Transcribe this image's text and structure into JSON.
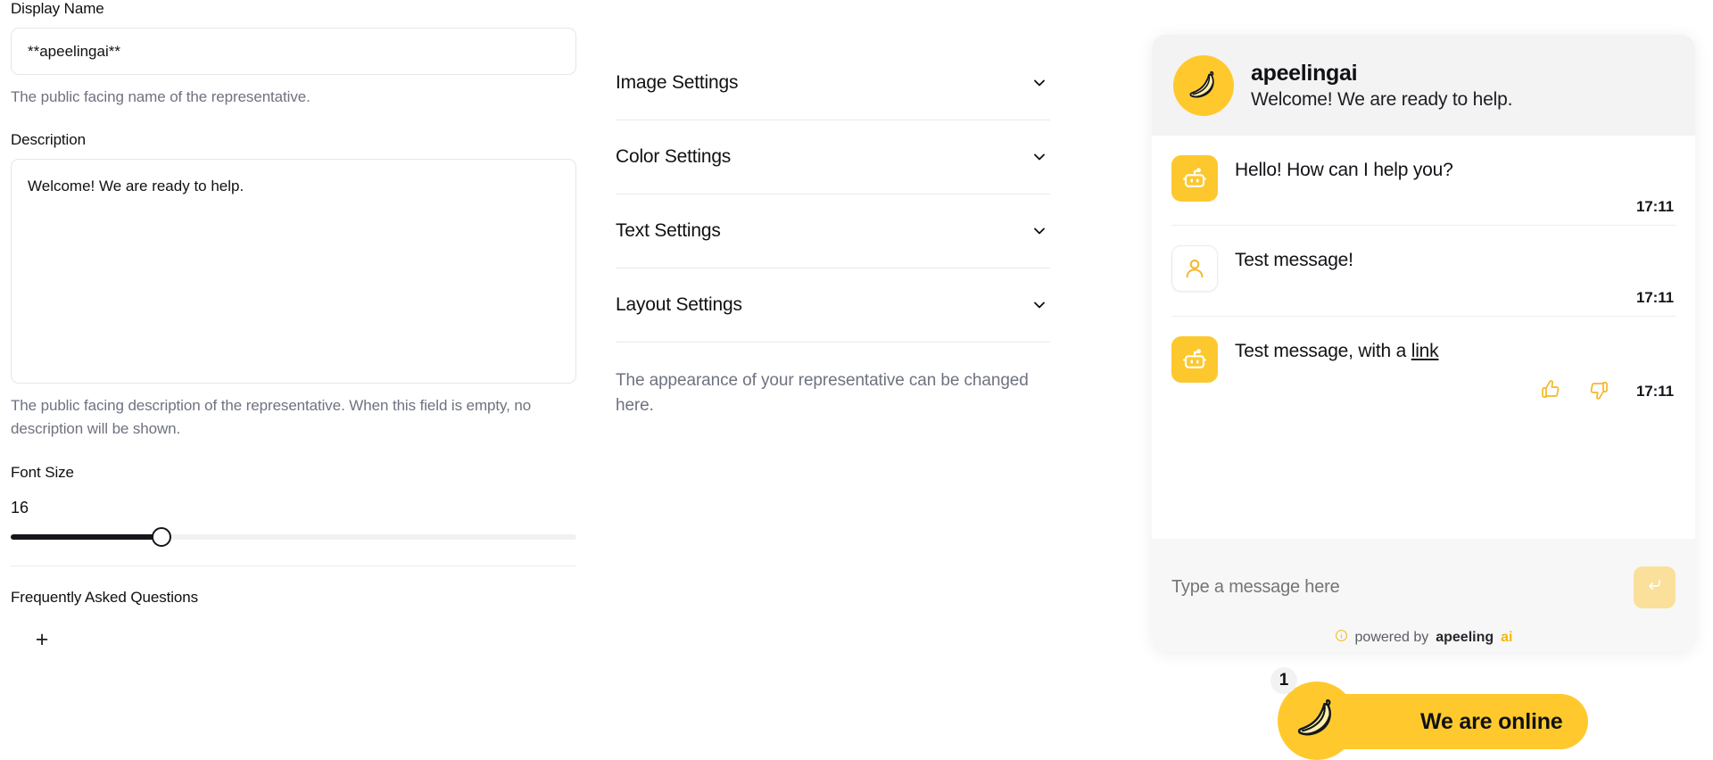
{
  "form": {
    "display_name_label": "Display Name",
    "display_name_value": "**apeelingai**",
    "display_name_helper": "The public facing name of the representative.",
    "description_label": "Description",
    "description_value": "Welcome! We are ready to help.",
    "description_helper": "The public facing description of the representative. When this field is empty, no description will be shown.",
    "font_size_label": "Font Size",
    "font_size_value": "16",
    "faq_label": "Frequently Asked Questions",
    "faq_add_label": "+"
  },
  "settings": {
    "items": [
      {
        "label": "Image Settings",
        "icon": "chevron-down-icon"
      },
      {
        "label": "Color Settings",
        "icon": "chevron-down-icon"
      },
      {
        "label": "Text Settings",
        "icon": "chevron-down-icon"
      },
      {
        "label": "Layout Settings",
        "icon": "chevron-down-icon"
      }
    ],
    "note": "The appearance of your representative can be changed here."
  },
  "widget": {
    "header": {
      "avatar_icon": "banana-icon",
      "name": "apeelingai",
      "subtitle": "Welcome! We are ready to help."
    },
    "messages": [
      {
        "sender": "bot",
        "avatar_icon": "robot-icon",
        "text": "Hello! How can I help you?",
        "time": "17:11",
        "has_reactions": false
      },
      {
        "sender": "user",
        "avatar_icon": "user-icon",
        "text": "Test message!",
        "time": "17:11",
        "has_reactions": false
      },
      {
        "sender": "bot",
        "avatar_icon": "robot-icon",
        "text": "Test message, with a ",
        "link_text": "link",
        "time": "17:11",
        "has_reactions": true,
        "thumbs_up_icon": "thumbs-up-icon",
        "thumbs_down_icon": "thumbs-down-icon"
      }
    ],
    "composer": {
      "placeholder": "Type a message here",
      "send_icon": "enter-arrow-icon"
    },
    "footer": {
      "info_icon": "info-icon",
      "prefix": "powered by",
      "brand": "apeeling",
      "brand_accent": "ai"
    }
  },
  "launcher": {
    "badge_count": "1",
    "avatar_icon": "banana-icon",
    "label": "We are online"
  },
  "colors": {
    "brand_yellow": "#ffc92e",
    "bot_avatar_yellow": "#fdc82e",
    "send_button_yellow": "#fae09a",
    "accent_text_yellow": "#f5b800",
    "widget_bg": "#f7f7f8",
    "slider_fill": "#15161a"
  }
}
